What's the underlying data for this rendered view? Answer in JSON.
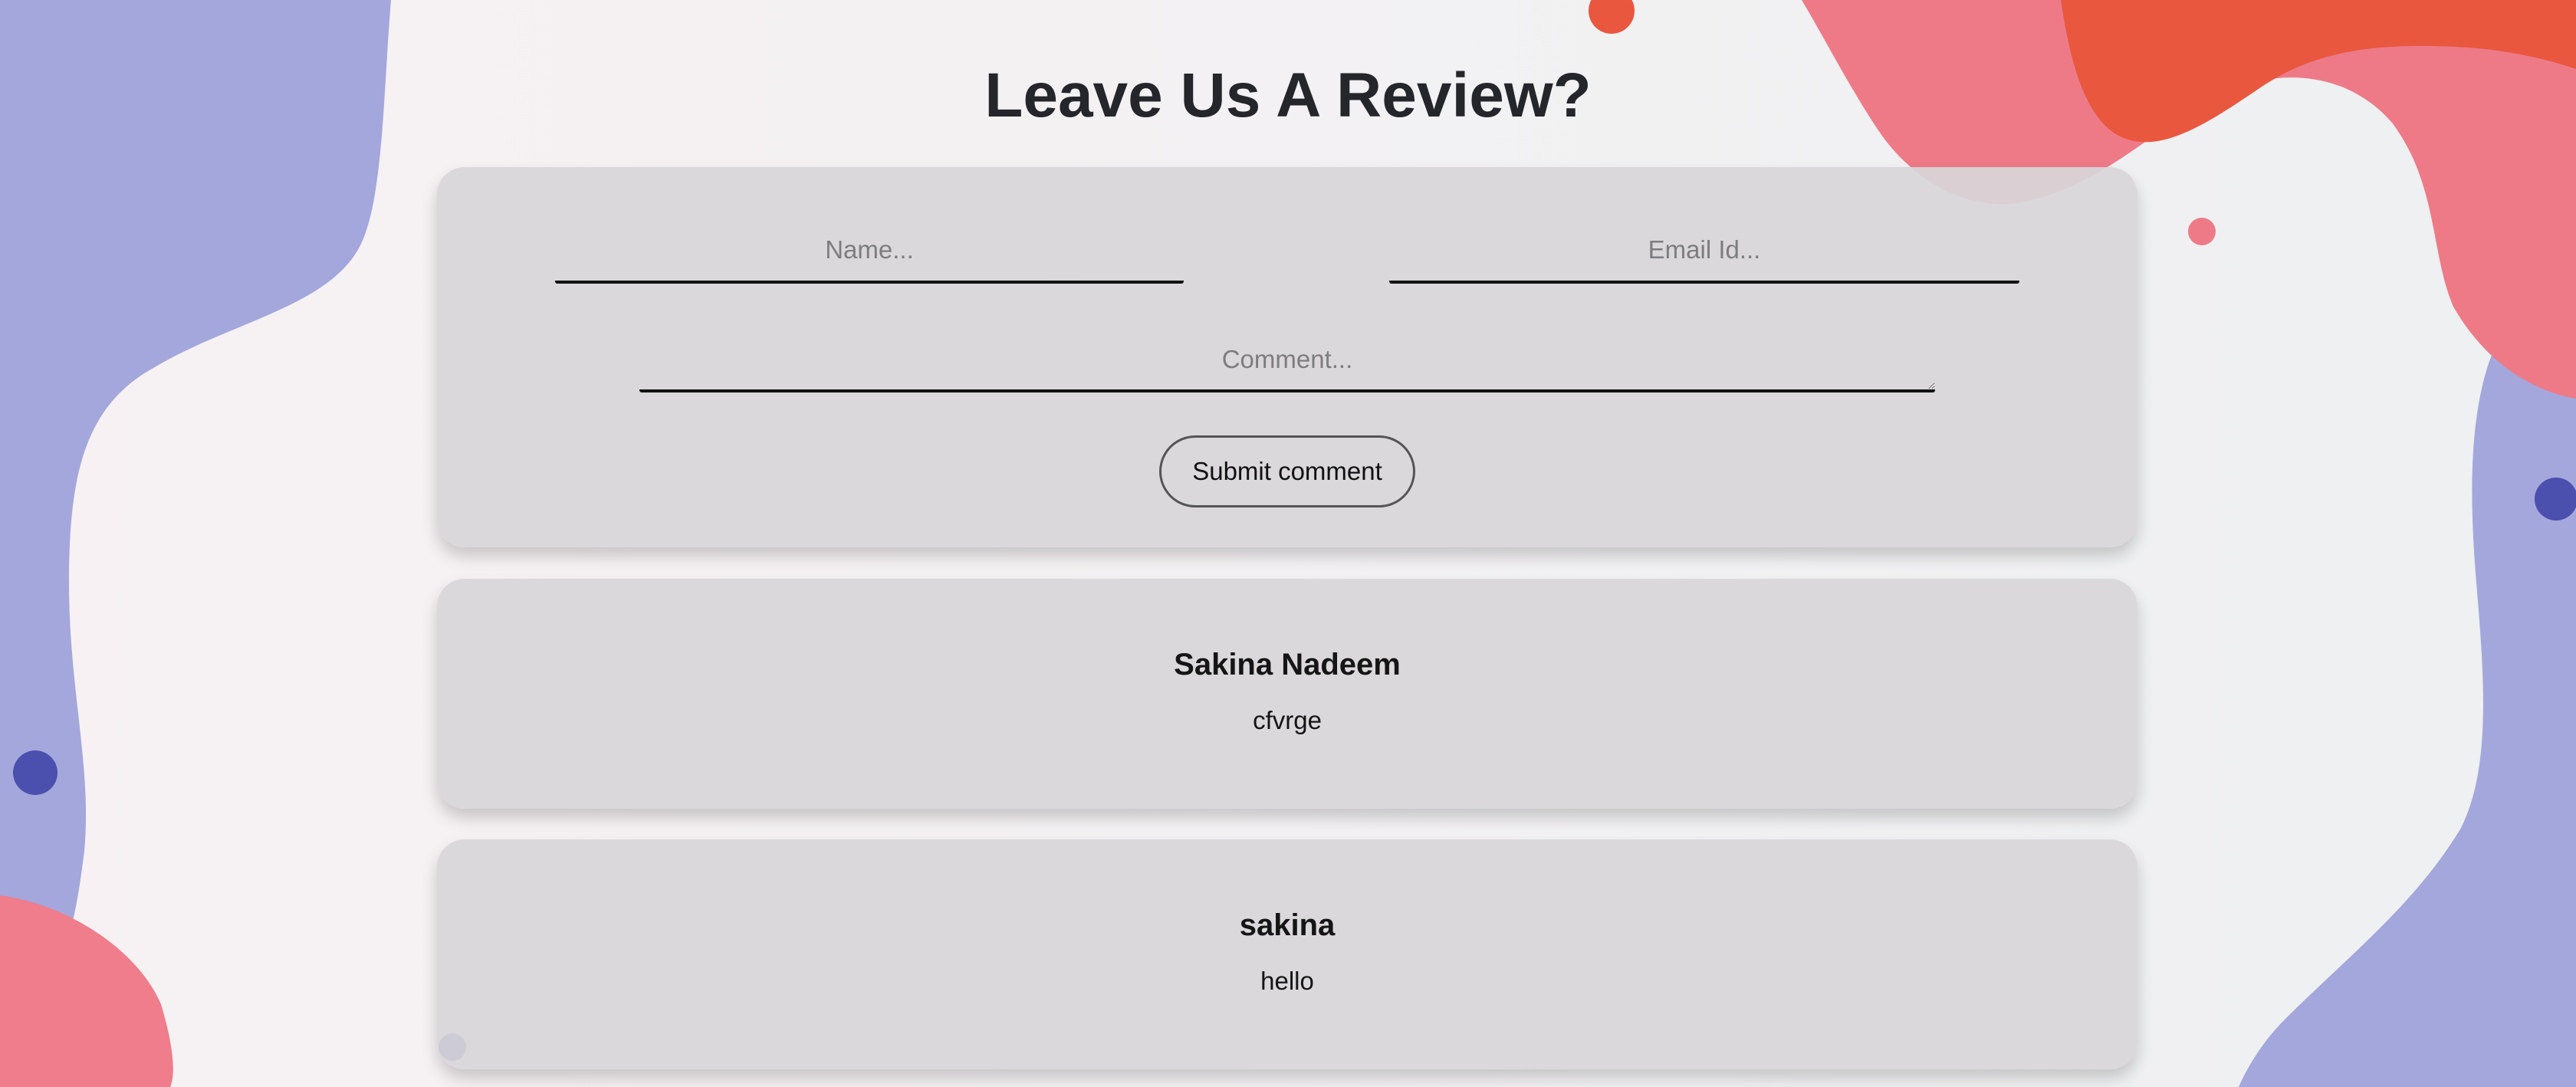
{
  "page": {
    "title": "Leave Us A Review?"
  },
  "form": {
    "name_placeholder": "Name...",
    "name_value": "",
    "email_placeholder": "Email Id...",
    "email_value": "",
    "comment_placeholder": "Comment...",
    "comment_value": "",
    "submit_label": "Submit comment"
  },
  "comments": [
    {
      "author": "Sakina Nadeem",
      "text": "cfvrge"
    },
    {
      "author": "sakina",
      "text": "hello"
    }
  ],
  "colors": {
    "blob_purple": "#a3a7dc",
    "blob_pink": "#ee7a88",
    "blob_orange": "#e9573f",
    "dot_blue": "#4b4fad",
    "card_bg": "#d8d6d9"
  }
}
